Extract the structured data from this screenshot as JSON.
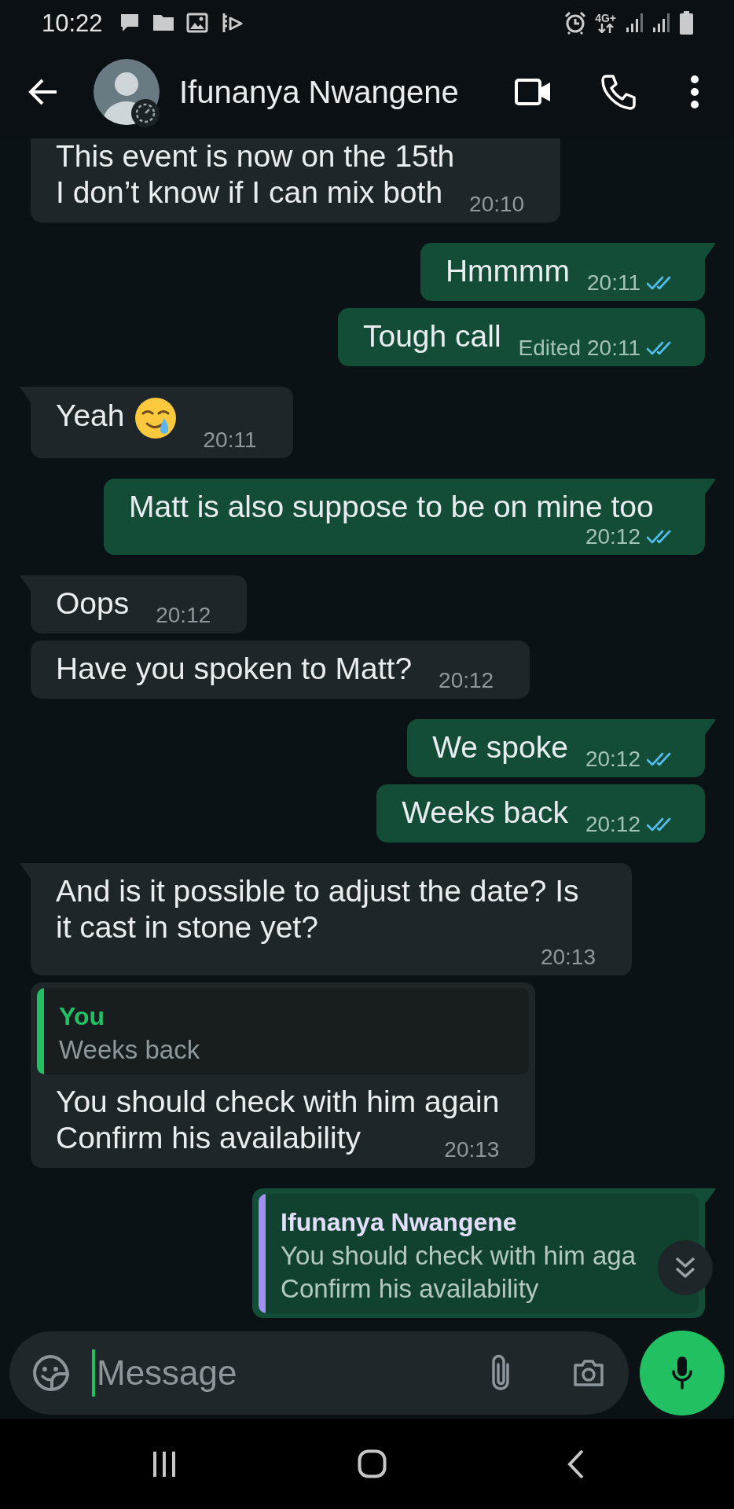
{
  "status_bar": {
    "time": "10:22",
    "network": "4G+"
  },
  "header": {
    "name": "Ifunanya Nwangene"
  },
  "messages": [
    {
      "outgoing": false,
      "kind": "text",
      "tail": false,
      "text": "This event is now on the 15th\nI don’t know if I can mix both",
      "time": "20:10"
    },
    {
      "outgoing": true,
      "kind": "text",
      "tail": true,
      "text": "Hmmmm",
      "time": "20:11",
      "read": true
    },
    {
      "outgoing": true,
      "kind": "text",
      "tail": false,
      "text": "Tough call",
      "edited_label": "Edited",
      "time": "20:11",
      "read": true
    },
    {
      "outgoing": false,
      "kind": "emoji_text",
      "tail": true,
      "text": "Yeah",
      "time": "20:11"
    },
    {
      "outgoing": true,
      "kind": "text",
      "tail": true,
      "text": "Matt is also suppose to be on mine too",
      "time": "20:12",
      "read": true
    },
    {
      "outgoing": false,
      "kind": "text",
      "tail": true,
      "text": "Oops",
      "time": "20:12"
    },
    {
      "outgoing": false,
      "kind": "text",
      "tail": false,
      "text": "Have you spoken to Matt?",
      "time": "20:12"
    },
    {
      "outgoing": true,
      "kind": "text",
      "tail": true,
      "text": "We spoke",
      "time": "20:12",
      "read": true
    },
    {
      "outgoing": true,
      "kind": "text",
      "tail": false,
      "text": "Weeks back",
      "time": "20:12",
      "read": true
    },
    {
      "outgoing": false,
      "kind": "text",
      "tail": true,
      "text": "And is it possible to adjust the date? Is it cast in stone yet?",
      "time": "20:13"
    },
    {
      "outgoing": false,
      "kind": "reply",
      "tail": false,
      "reply_to": {
        "author": "You",
        "text": "Weeks back",
        "color": "#21c063"
      },
      "text": "You should check with him again\nConfirm his availability",
      "time": "20:13"
    },
    {
      "outgoing": true,
      "kind": "reply",
      "tail": true,
      "reply_to": {
        "author": "Ifunanya Nwangene",
        "text": "You should check with him aga\nConfirm his availability",
        "color": "#a190f5"
      }
    }
  ],
  "composer": {
    "placeholder": "Message",
    "focused": true
  }
}
